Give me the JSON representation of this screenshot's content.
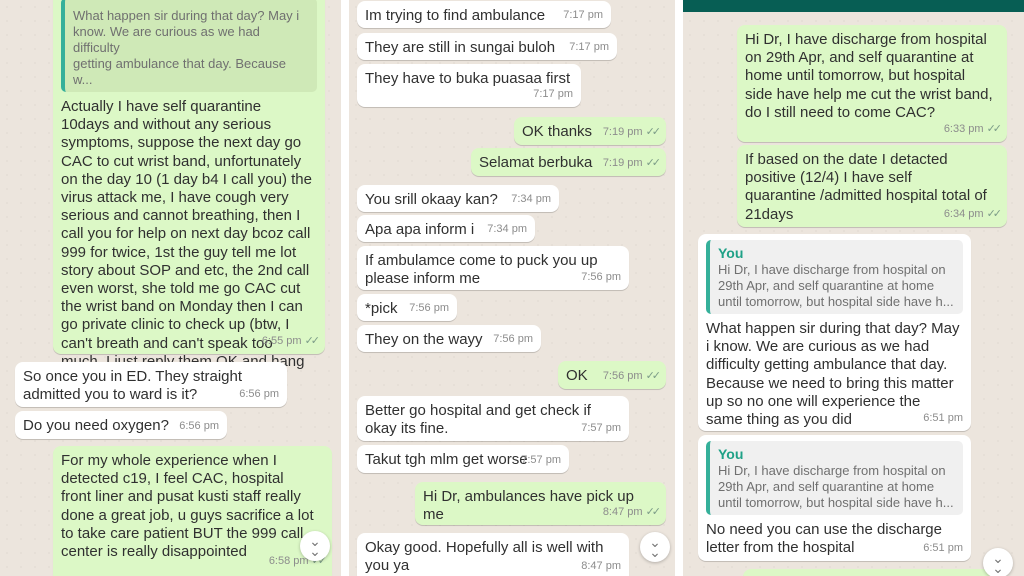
{
  "colors": {
    "incoming": "#ffffff",
    "outgoing": "#dcf8c6",
    "wallpaper": "#ece5dd",
    "quote_accent": "#35b09a",
    "header": "#075e54"
  },
  "left": {
    "messages": [
      {
        "id": "l1",
        "dir": "out",
        "quote_text": "What happen sir during that day? May i\nknow. We are curious as we had difficulty\ngetting ambulance that day. Because w...",
        "text": "Actually I have self quarantine\n10days and without any serious\nsymptoms, suppose the next day go\nCAC to cut wrist band, unfortunately\non the day 10 (1 day b4 I call you) the\nvirus attack me, I have cough very\nserious and cannot breathing, then I\ncall you for help on next day bcoz call\n999 for twice, 1st the guy tell me lot\nstory about SOP and etc, the 2nd call\neven worst, she told me go CAC cut\nthe wrist band on Monday then I can\ngo private clinic to check up (btw, I\ncan't breath and can't speak too\nmuch, I just reply them OK and hang\nup) then call you for help",
        "time": "6:55 pm"
      },
      {
        "id": "l2",
        "dir": "in",
        "text": "So once you in ED. They straight\nadmitted you to ward is it?",
        "time": "6:56 pm"
      },
      {
        "id": "l3",
        "dir": "in",
        "text": "Do you need oxygen?",
        "time": "6:56 pm"
      },
      {
        "id": "l4",
        "dir": "out",
        "text": "For my whole experience when I\ndetected c19, I feel CAC, hospital\nfront liner and pusat kusti staff really\ndone a great job, u guys sacrifice a lot\nto take care patient BUT the 999 call\ncenter is really disappointed",
        "time": "6:58 pm"
      }
    ]
  },
  "middle": {
    "messages": [
      {
        "id": "m1",
        "dir": "in",
        "text": "Im trying to find ambulance",
        "time": "7:17 pm"
      },
      {
        "id": "m2",
        "dir": "in",
        "text": "They are still in sungai buloh",
        "time": "7:17 pm"
      },
      {
        "id": "m3",
        "dir": "in",
        "text": "They have to buka puasaa first",
        "time": "7:17 pm"
      },
      {
        "id": "m4",
        "dir": "out",
        "text": "OK thanks",
        "time": "7:19 pm"
      },
      {
        "id": "m5",
        "dir": "out",
        "text": "Selamat berbuka",
        "time": "7:19 pm"
      },
      {
        "id": "m6",
        "dir": "in",
        "text": "You srill okaay kan?",
        "time": "7:34 pm"
      },
      {
        "id": "m7",
        "dir": "in",
        "text": "Apa apa inform i",
        "time": "7:34 pm"
      },
      {
        "id": "m8",
        "dir": "in",
        "text": "If ambulamce come to puck you up\nplease inform me",
        "time": "7:56 pm"
      },
      {
        "id": "m9",
        "dir": "in",
        "text": "*pick",
        "time": "7:56 pm"
      },
      {
        "id": "m10",
        "dir": "in",
        "text": "They on the wayy",
        "time": "7:56 pm"
      },
      {
        "id": "m11",
        "dir": "out",
        "text": "OK",
        "time": "7:56 pm"
      },
      {
        "id": "m12",
        "dir": "in",
        "text": "Better go hospital and get check if\nokay its fine.",
        "time": "7:57 pm"
      },
      {
        "id": "m13",
        "dir": "in",
        "text": "Takut tgh mlm get worse",
        "time": "7:57 pm"
      },
      {
        "id": "m14",
        "dir": "out",
        "text": "Hi Dr, ambulances have pick up me",
        "time": "8:47 pm"
      },
      {
        "id": "m15",
        "dir": "in",
        "text": "Okay good. Hopefully all is well with\nyou ya",
        "time": "8:47 pm"
      }
    ]
  },
  "right": {
    "messages": [
      {
        "id": "r1",
        "dir": "out",
        "text": "Hi Dr, I have discharge from hospital\non 29th Apr, and self quarantine at\nhome until tomorrow, but hospital\nside have help me cut the wrist band,\ndo I still need to come CAC?",
        "time": "6:33 pm"
      },
      {
        "id": "r2",
        "dir": "out",
        "text": "If based on the date I detacted\npositive (12/4) I have self\nquarantine /admitted hospital total of\n21days",
        "time": "6:34 pm"
      },
      {
        "id": "r3",
        "dir": "in",
        "quote_name": "You",
        "quote_text": "Hi Dr, I have discharge from hospital on\n29th Apr, and self quarantine at home\nuntil tomorrow, but hospital side have h...",
        "text": "What happen sir during that day? May\ni know. We are curious as we had\ndifficulty getting ambulance that day.\nBecause we need to bring this matter\nup so no one will experience the\nsame thing as you did",
        "time": "6:51 pm"
      },
      {
        "id": "r4",
        "dir": "in",
        "quote_name": "You",
        "quote_text": "Hi Dr, I have discharge from hospital on\n29th Apr, and self quarantine at home\nuntil tomorrow, but hospital side have h...",
        "text": "No need you can use the discharge\nletter from the hospital",
        "time": "6:51 pm"
      }
    ]
  },
  "icons": {
    "scroll_down": "chevron-double-down-icon",
    "read": "double-check-icon"
  }
}
